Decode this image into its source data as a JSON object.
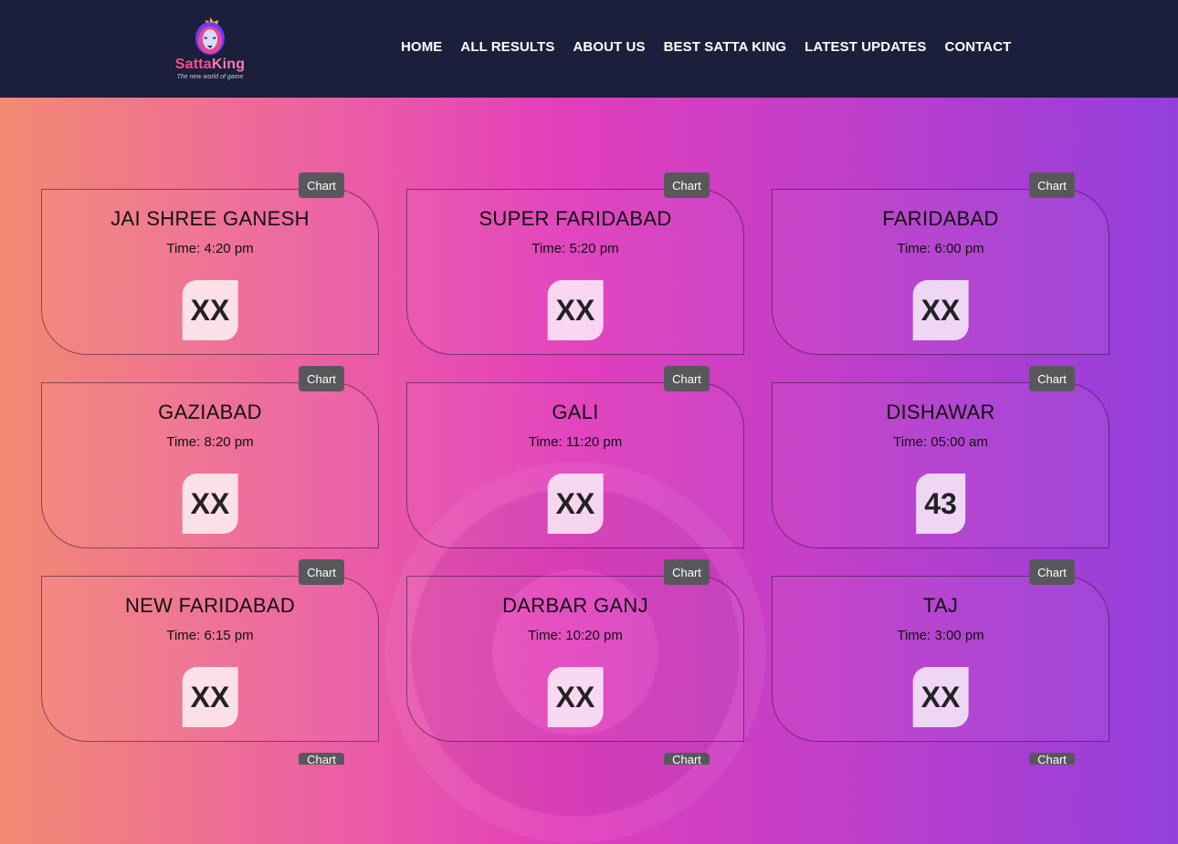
{
  "brand": {
    "name_part1": "Satta",
    "name_part2": "King",
    "tagline": "The new world of game"
  },
  "nav": [
    "HOME",
    "ALL RESULTS",
    "ABOUT US",
    "BEST SATTA KING",
    "LATEST UPDATES",
    "CONTACT"
  ],
  "chart_label": "Chart",
  "games": [
    {
      "title": "JAI SHREE GANESH",
      "time": "Time: 4:20 pm",
      "result": "XX"
    },
    {
      "title": "SUPER FARIDABAD",
      "time": "Time: 5:20 pm",
      "result": "XX"
    },
    {
      "title": "FARIDABAD",
      "time": "Time: 6:00 pm",
      "result": "XX"
    },
    {
      "title": "GAZIABAD",
      "time": "Time: 8:20 pm",
      "result": "XX"
    },
    {
      "title": "GALI",
      "time": "Time: 11:20 pm",
      "result": "XX"
    },
    {
      "title": "DISHAWAR",
      "time": "Time: 05:00 am",
      "result": "43"
    },
    {
      "title": "NEW FARIDABAD",
      "time": "Time: 6:15 pm",
      "result": "XX"
    },
    {
      "title": "DARBAR GANJ",
      "time": "Time: 10:20 pm",
      "result": "XX"
    },
    {
      "title": "TAJ",
      "time": "Time: 3:00 pm",
      "result": "XX"
    }
  ],
  "colors": {
    "header_bg": "#1b1f3b",
    "chart_button": "#58585c",
    "brand_pink": "#ff4d8d"
  }
}
